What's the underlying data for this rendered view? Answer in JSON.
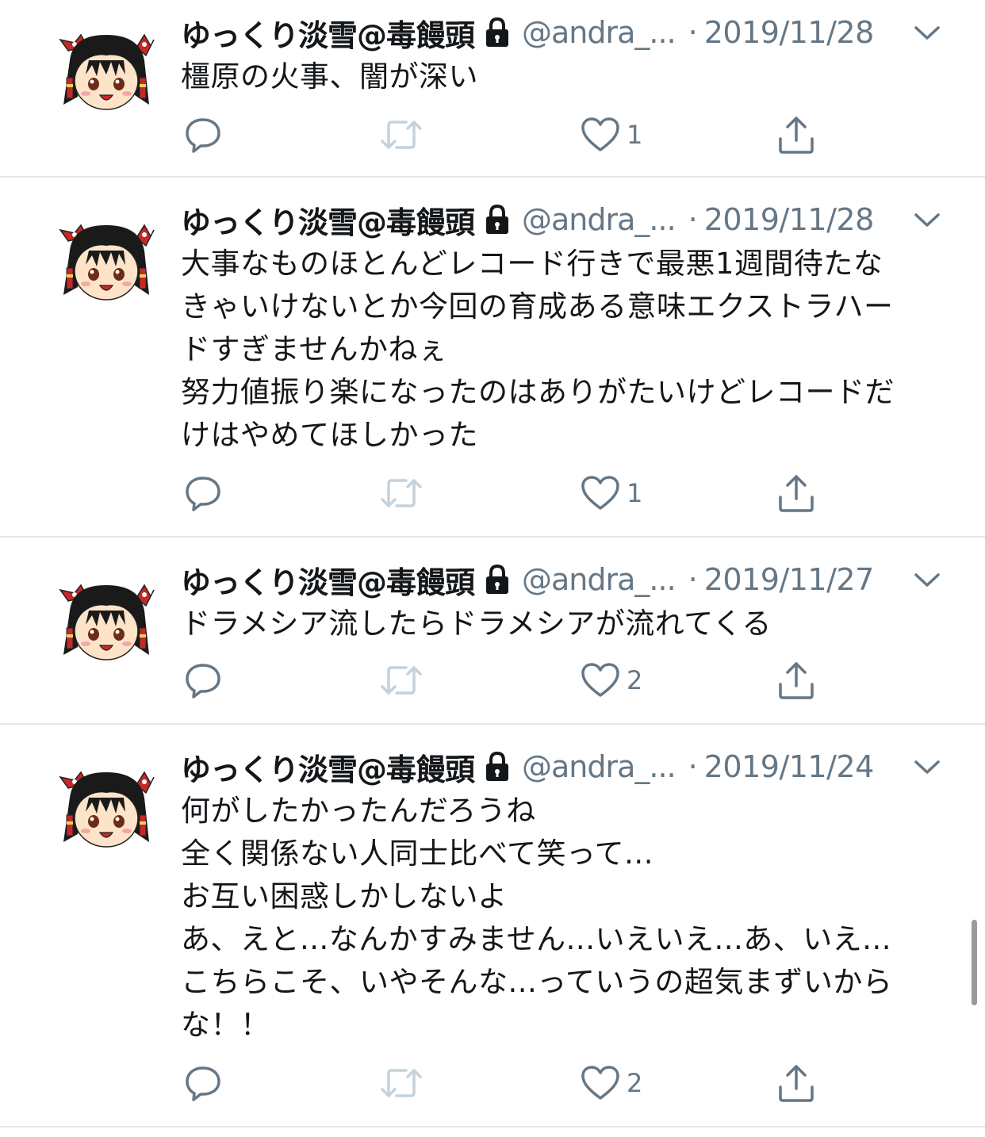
{
  "tweets": [
    {
      "name": "ゆっくり淡雪@毒饅頭",
      "handle": "@andra_...",
      "separator": "·",
      "date": "2019/11/28",
      "text": "橿原の火事、闇が深い",
      "like_count": "1"
    },
    {
      "name": "ゆっくり淡雪@毒饅頭",
      "handle": "@andra_...",
      "separator": "·",
      "date": "2019/11/28",
      "text": "大事なものほとんどレコード行きで最悪1週間待たな\nきゃいけないとか今回の育成ある意味エクストラハー\nドすぎませんかねぇ\n努力値振り楽になったのはありがたいけどレコードだ\nけはやめてほしかった",
      "like_count": "1"
    },
    {
      "name": "ゆっくり淡雪@毒饅頭",
      "handle": "@andra_...",
      "separator": "·",
      "date": "2019/11/27",
      "text": "ドラメシア流したらドラメシアが流れてくる",
      "like_count": "2"
    },
    {
      "name": "ゆっくり淡雪@毒饅頭",
      "handle": "@andra_...",
      "separator": "·",
      "date": "2019/11/24",
      "text": "何がしたかったんだろうね\n全く関係ない人同士比べて笑って...\nお互い困惑しかしないよ\nあ、えと...なんかすみません...いえいえ...あ、いえ...\nこちらこそ、いやそんな...っていうの超気まずいから\nな！！",
      "like_count": "2"
    }
  ],
  "icons": {
    "avatar": "yukkuri-reimu-avatar",
    "lock": "lock-icon",
    "menu": "chevron-down-icon",
    "reply": "reply-icon",
    "retweet": "retweet-icon",
    "like": "heart-icon",
    "share": "share-icon"
  },
  "colors": {
    "text": "#14171a",
    "secondary": "#657786",
    "icon": "#657786",
    "retweet_disabled": "#c4d2dc",
    "divider": "#e1e8ed"
  }
}
